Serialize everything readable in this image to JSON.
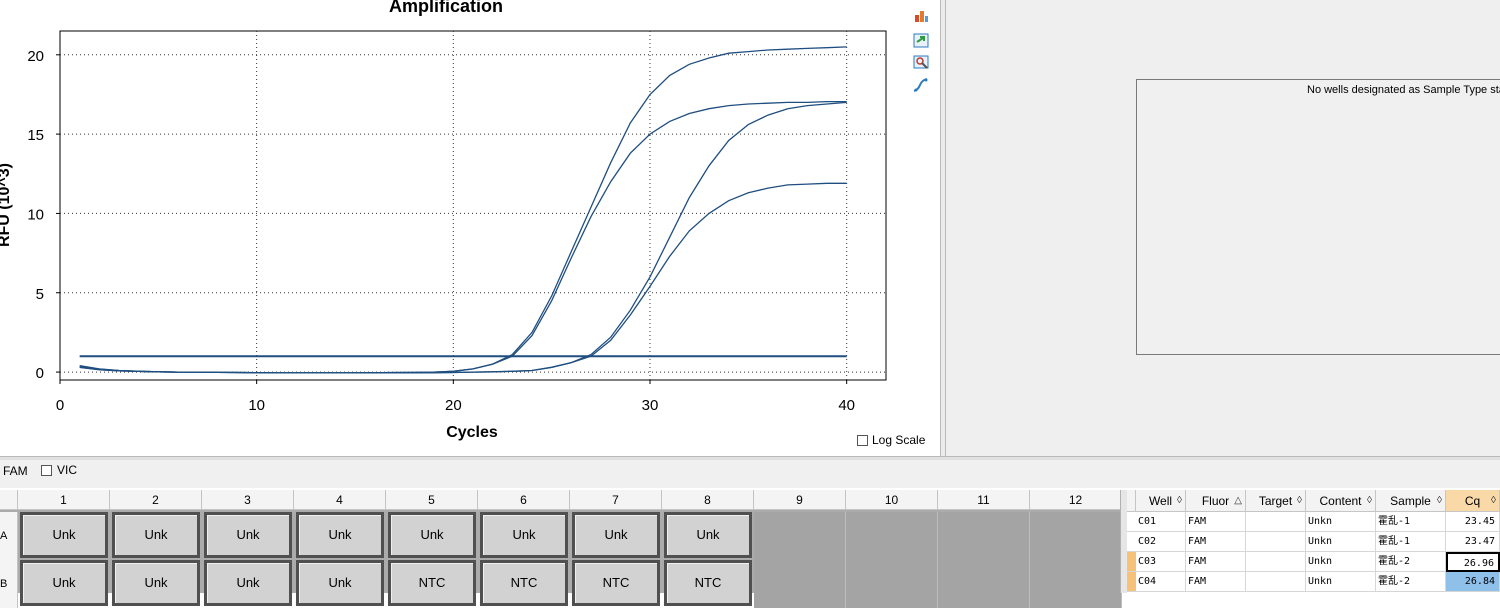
{
  "chart_data": {
    "type": "line",
    "title": "Amplification",
    "xlabel": "Cycles",
    "ylabel": "RFU (10^3)",
    "xlim": [
      0,
      42
    ],
    "ylim": [
      -0.5,
      21.5
    ],
    "xticks": [
      0,
      10,
      20,
      30,
      40
    ],
    "yticks": [
      0,
      5,
      10,
      15,
      20
    ],
    "grid": true,
    "threshold": 1.0,
    "series": [
      {
        "x": [
          1,
          2,
          3,
          4,
          5,
          6,
          7,
          8,
          9,
          10,
          11,
          12,
          13,
          14,
          15,
          16,
          17,
          18,
          19,
          20,
          21,
          22,
          23,
          24,
          25,
          26,
          27,
          28,
          29,
          30,
          31,
          32,
          33,
          34,
          35,
          36,
          37,
          38,
          39,
          40
        ],
        "values": [
          0.35,
          0.18,
          0.1,
          0.05,
          0.02,
          0,
          0,
          -0.02,
          -0.03,
          -0.04,
          -0.05,
          -0.05,
          -0.05,
          -0.05,
          -0.05,
          -0.04,
          -0.03,
          -0.02,
          0,
          0.05,
          0.2,
          0.5,
          1.1,
          2.5,
          4.8,
          7.6,
          10.4,
          13.2,
          15.7,
          17.5,
          18.7,
          19.4,
          19.8,
          20.1,
          20.2,
          20.3,
          20.35,
          20.4,
          20.45,
          20.5
        ]
      },
      {
        "x": [
          1,
          2,
          3,
          4,
          5,
          6,
          7,
          8,
          9,
          10,
          11,
          12,
          13,
          14,
          15,
          16,
          17,
          18,
          19,
          20,
          21,
          22,
          23,
          24,
          25,
          26,
          27,
          28,
          29,
          30,
          31,
          32,
          33,
          34,
          35,
          36,
          37,
          38,
          39,
          40
        ],
        "values": [
          0.3,
          0.15,
          0.08,
          0.04,
          0.02,
          0,
          -0.01,
          -0.02,
          -0.03,
          -0.04,
          -0.05,
          -0.05,
          -0.05,
          -0.05,
          -0.05,
          -0.04,
          -0.03,
          -0.02,
          0,
          0.05,
          0.2,
          0.5,
          1.0,
          2.3,
          4.5,
          7.2,
          9.8,
          12.0,
          13.8,
          15.0,
          15.8,
          16.3,
          16.6,
          16.8,
          16.9,
          16.95,
          17.0,
          17.0,
          17.05,
          17.05
        ]
      },
      {
        "x": [
          1,
          2,
          3,
          4,
          5,
          6,
          7,
          8,
          9,
          10,
          11,
          12,
          13,
          14,
          15,
          16,
          17,
          18,
          19,
          20,
          21,
          22,
          23,
          24,
          25,
          26,
          27,
          28,
          29,
          30,
          31,
          32,
          33,
          34,
          35,
          36,
          37,
          38,
          39,
          40
        ],
        "values": [
          0.4,
          0.2,
          0.1,
          0.05,
          0.02,
          0,
          0,
          -0.02,
          -0.03,
          -0.04,
          -0.05,
          -0.05,
          -0.05,
          -0.05,
          -0.05,
          -0.05,
          -0.05,
          -0.05,
          -0.04,
          -0.03,
          0,
          0.02,
          0.05,
          0.1,
          0.3,
          0.6,
          1.1,
          2.2,
          3.9,
          6.0,
          8.5,
          11.0,
          13.0,
          14.6,
          15.6,
          16.2,
          16.6,
          16.8,
          16.9,
          17.0
        ]
      },
      {
        "x": [
          1,
          2,
          3,
          4,
          5,
          6,
          7,
          8,
          9,
          10,
          11,
          12,
          13,
          14,
          15,
          16,
          17,
          18,
          19,
          20,
          21,
          22,
          23,
          24,
          25,
          26,
          27,
          28,
          29,
          30,
          31,
          32,
          33,
          34,
          35,
          36,
          37,
          38,
          39,
          40
        ],
        "values": [
          0.3,
          0.15,
          0.08,
          0.04,
          0.02,
          0,
          0,
          -0.02,
          -0.03,
          -0.04,
          -0.05,
          -0.05,
          -0.05,
          -0.05,
          -0.05,
          -0.05,
          -0.05,
          -0.05,
          -0.04,
          -0.03,
          0,
          0.02,
          0.05,
          0.1,
          0.3,
          0.6,
          1.0,
          2.0,
          3.6,
          5.4,
          7.3,
          8.9,
          10.0,
          10.8,
          11.3,
          11.6,
          11.8,
          11.85,
          11.9,
          11.9
        ]
      }
    ]
  },
  "icons": [
    "chart-bar-icon",
    "export-icon",
    "zoom-icon",
    "curve-icon"
  ],
  "log_scale_label": "Log Scale",
  "standard_curve_message": "No wells designated as Sample Type standard",
  "fluors": {
    "fam": "FAM",
    "vic": "VIC"
  },
  "plate": {
    "columns": [
      "1",
      "2",
      "3",
      "4",
      "5",
      "6",
      "7",
      "8",
      "9",
      "10",
      "11",
      "12"
    ],
    "rows": [
      "A",
      "B"
    ],
    "wells": [
      [
        "Unk",
        "Unk",
        "Unk",
        "Unk",
        "Unk",
        "Unk",
        "Unk",
        "Unk",
        "",
        "",
        "",
        ""
      ],
      [
        "Unk",
        "Unk",
        "Unk",
        "Unk",
        "NTC",
        "NTC",
        "NTC",
        "NTC",
        "",
        "",
        "",
        ""
      ]
    ]
  },
  "results": {
    "headers": [
      "Well",
      "Fluor",
      "Target",
      "Content",
      "Sample",
      "Cq"
    ],
    "rows": [
      {
        "well": "C01",
        "fluor": "FAM",
        "target": "",
        "content": "Unkn",
        "sample": "霍乱-1",
        "cq": "23.45"
      },
      {
        "well": "C02",
        "fluor": "FAM",
        "target": "",
        "content": "Unkn",
        "sample": "霍乱-1",
        "cq": "23.47"
      },
      {
        "well": "C03",
        "fluor": "FAM",
        "target": "",
        "content": "Unkn",
        "sample": "霍乱-2",
        "cq": "26.96"
      },
      {
        "well": "C04",
        "fluor": "FAM",
        "target": "",
        "content": "Unkn",
        "sample": "霍乱-2",
        "cq": "26.84"
      }
    ]
  },
  "colors": {
    "curve": "#1f4e80",
    "threshold": "#1f4e80",
    "cq_header": "#f9d9a8",
    "row_marker": "#f6c27a",
    "selected_cell": "#8fc0ea"
  }
}
